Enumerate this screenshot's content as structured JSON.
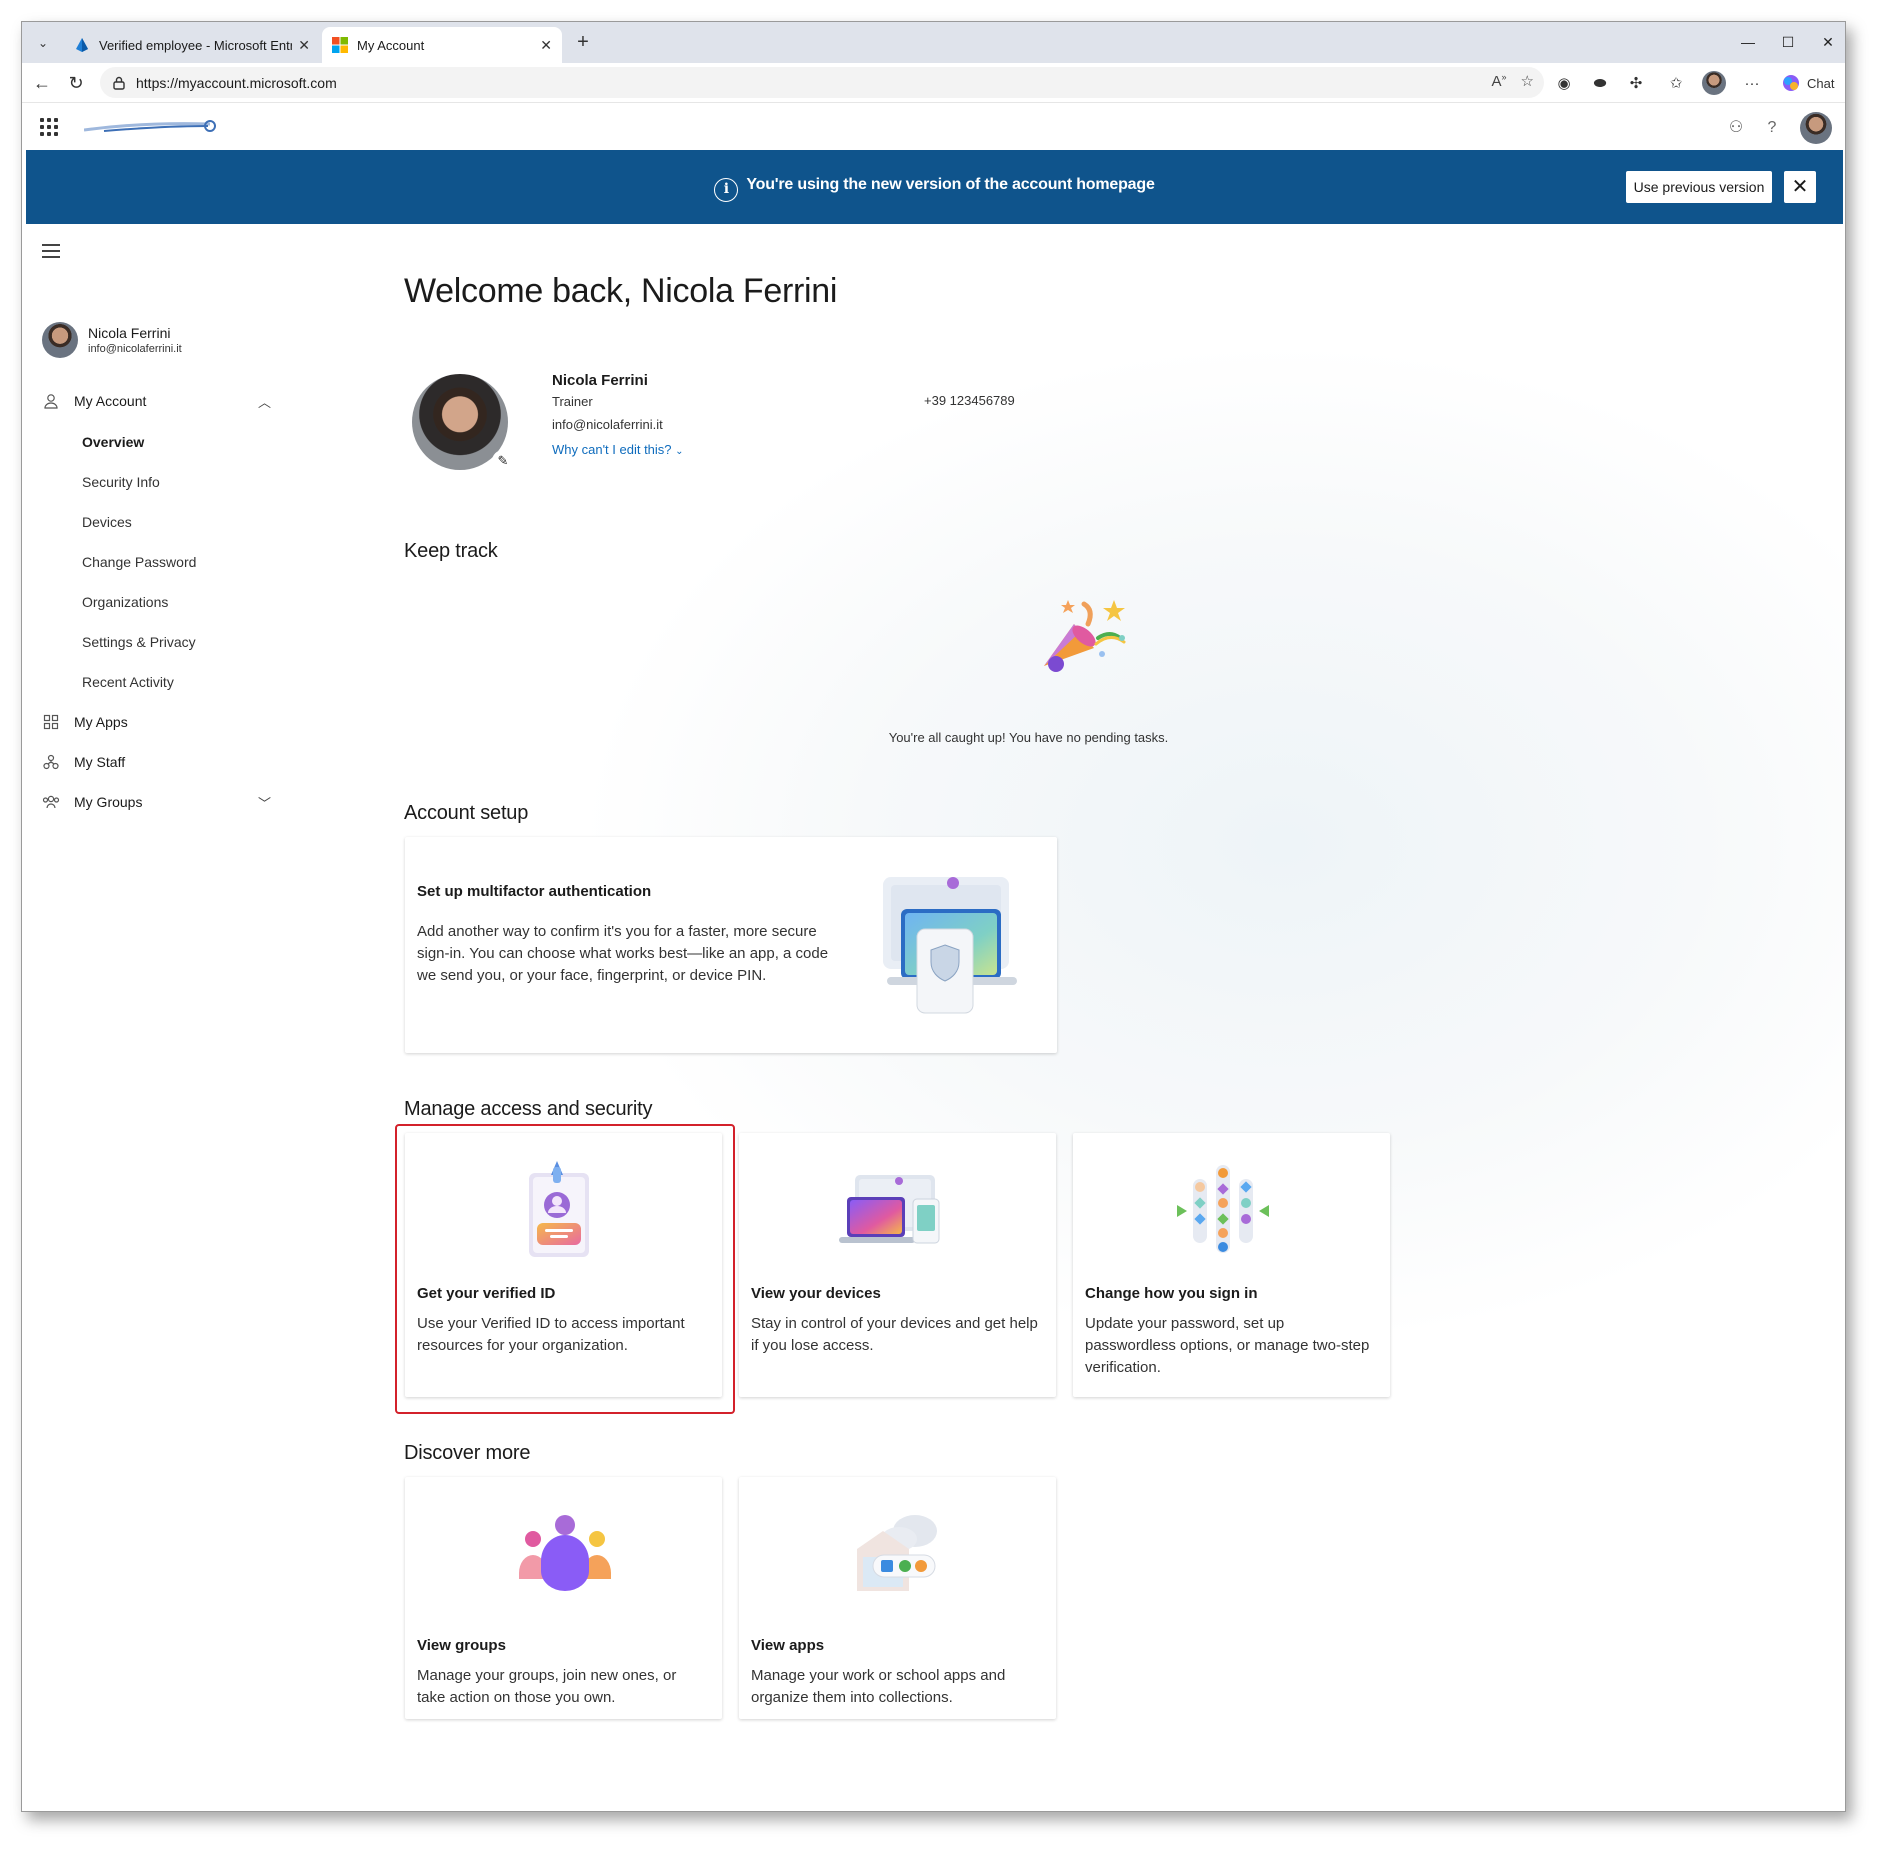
{
  "browser": {
    "tabs": [
      {
        "title": "Verified employee - Microsoft Entra"
      },
      {
        "title": "My Account"
      }
    ],
    "url": "https://myaccount.microsoft.com",
    "chat_label": "Chat"
  },
  "banner": {
    "message": "You're using the new version of the account homepage",
    "previous_button": "Use previous version",
    "close_glyph": "✕"
  },
  "sidebar": {
    "user": {
      "name": "Nicola Ferrini",
      "email": "info@nicolaferrini.it"
    },
    "my_account": "My Account",
    "subitems": [
      "Overview",
      "Security Info",
      "Devices",
      "Change Password",
      "Organizations",
      "Settings & Privacy",
      "Recent Activity"
    ],
    "my_apps": "My Apps",
    "my_staff": "My Staff",
    "my_groups": "My Groups"
  },
  "main": {
    "welcome": "Welcome back, Nicola Ferrini",
    "profile": {
      "name": "Nicola Ferrini",
      "role": "Trainer",
      "email": "info@nicolaferrini.it",
      "edit_link": "Why can't I edit this?",
      "phone": "+39 123456789"
    },
    "keep_track": {
      "title": "Keep track",
      "empty": "You're all caught up! You have no pending tasks."
    },
    "account_setup": {
      "title": "Account setup",
      "card": {
        "title": "Set up multifactor authentication",
        "desc": "Add another way to confirm it's you for a faster, more secure sign-in. You can choose what works best—like an app, a code we send you, or your face, fingerprint, or device PIN."
      }
    },
    "manage": {
      "title": "Manage access and security",
      "cards": [
        {
          "title": "Get your verified ID",
          "desc": "Use your Verified ID to access important resources for your organization."
        },
        {
          "title": "View your devices",
          "desc": "Stay in control of your devices and get help if you lose access."
        },
        {
          "title": "Change how you sign in",
          "desc": "Update your password, set up passwordless options, or manage two-step verification."
        }
      ]
    },
    "discover": {
      "title": "Discover more",
      "cards": [
        {
          "title": "View groups",
          "desc": "Manage your groups, join new ones, or take action on those you own."
        },
        {
          "title": "View apps",
          "desc": "Manage your work or school apps and organize them into collections."
        }
      ]
    }
  },
  "colors": {
    "banner": "#0f548c",
    "link": "#0f6cbd",
    "highlight": "#d3212b"
  }
}
